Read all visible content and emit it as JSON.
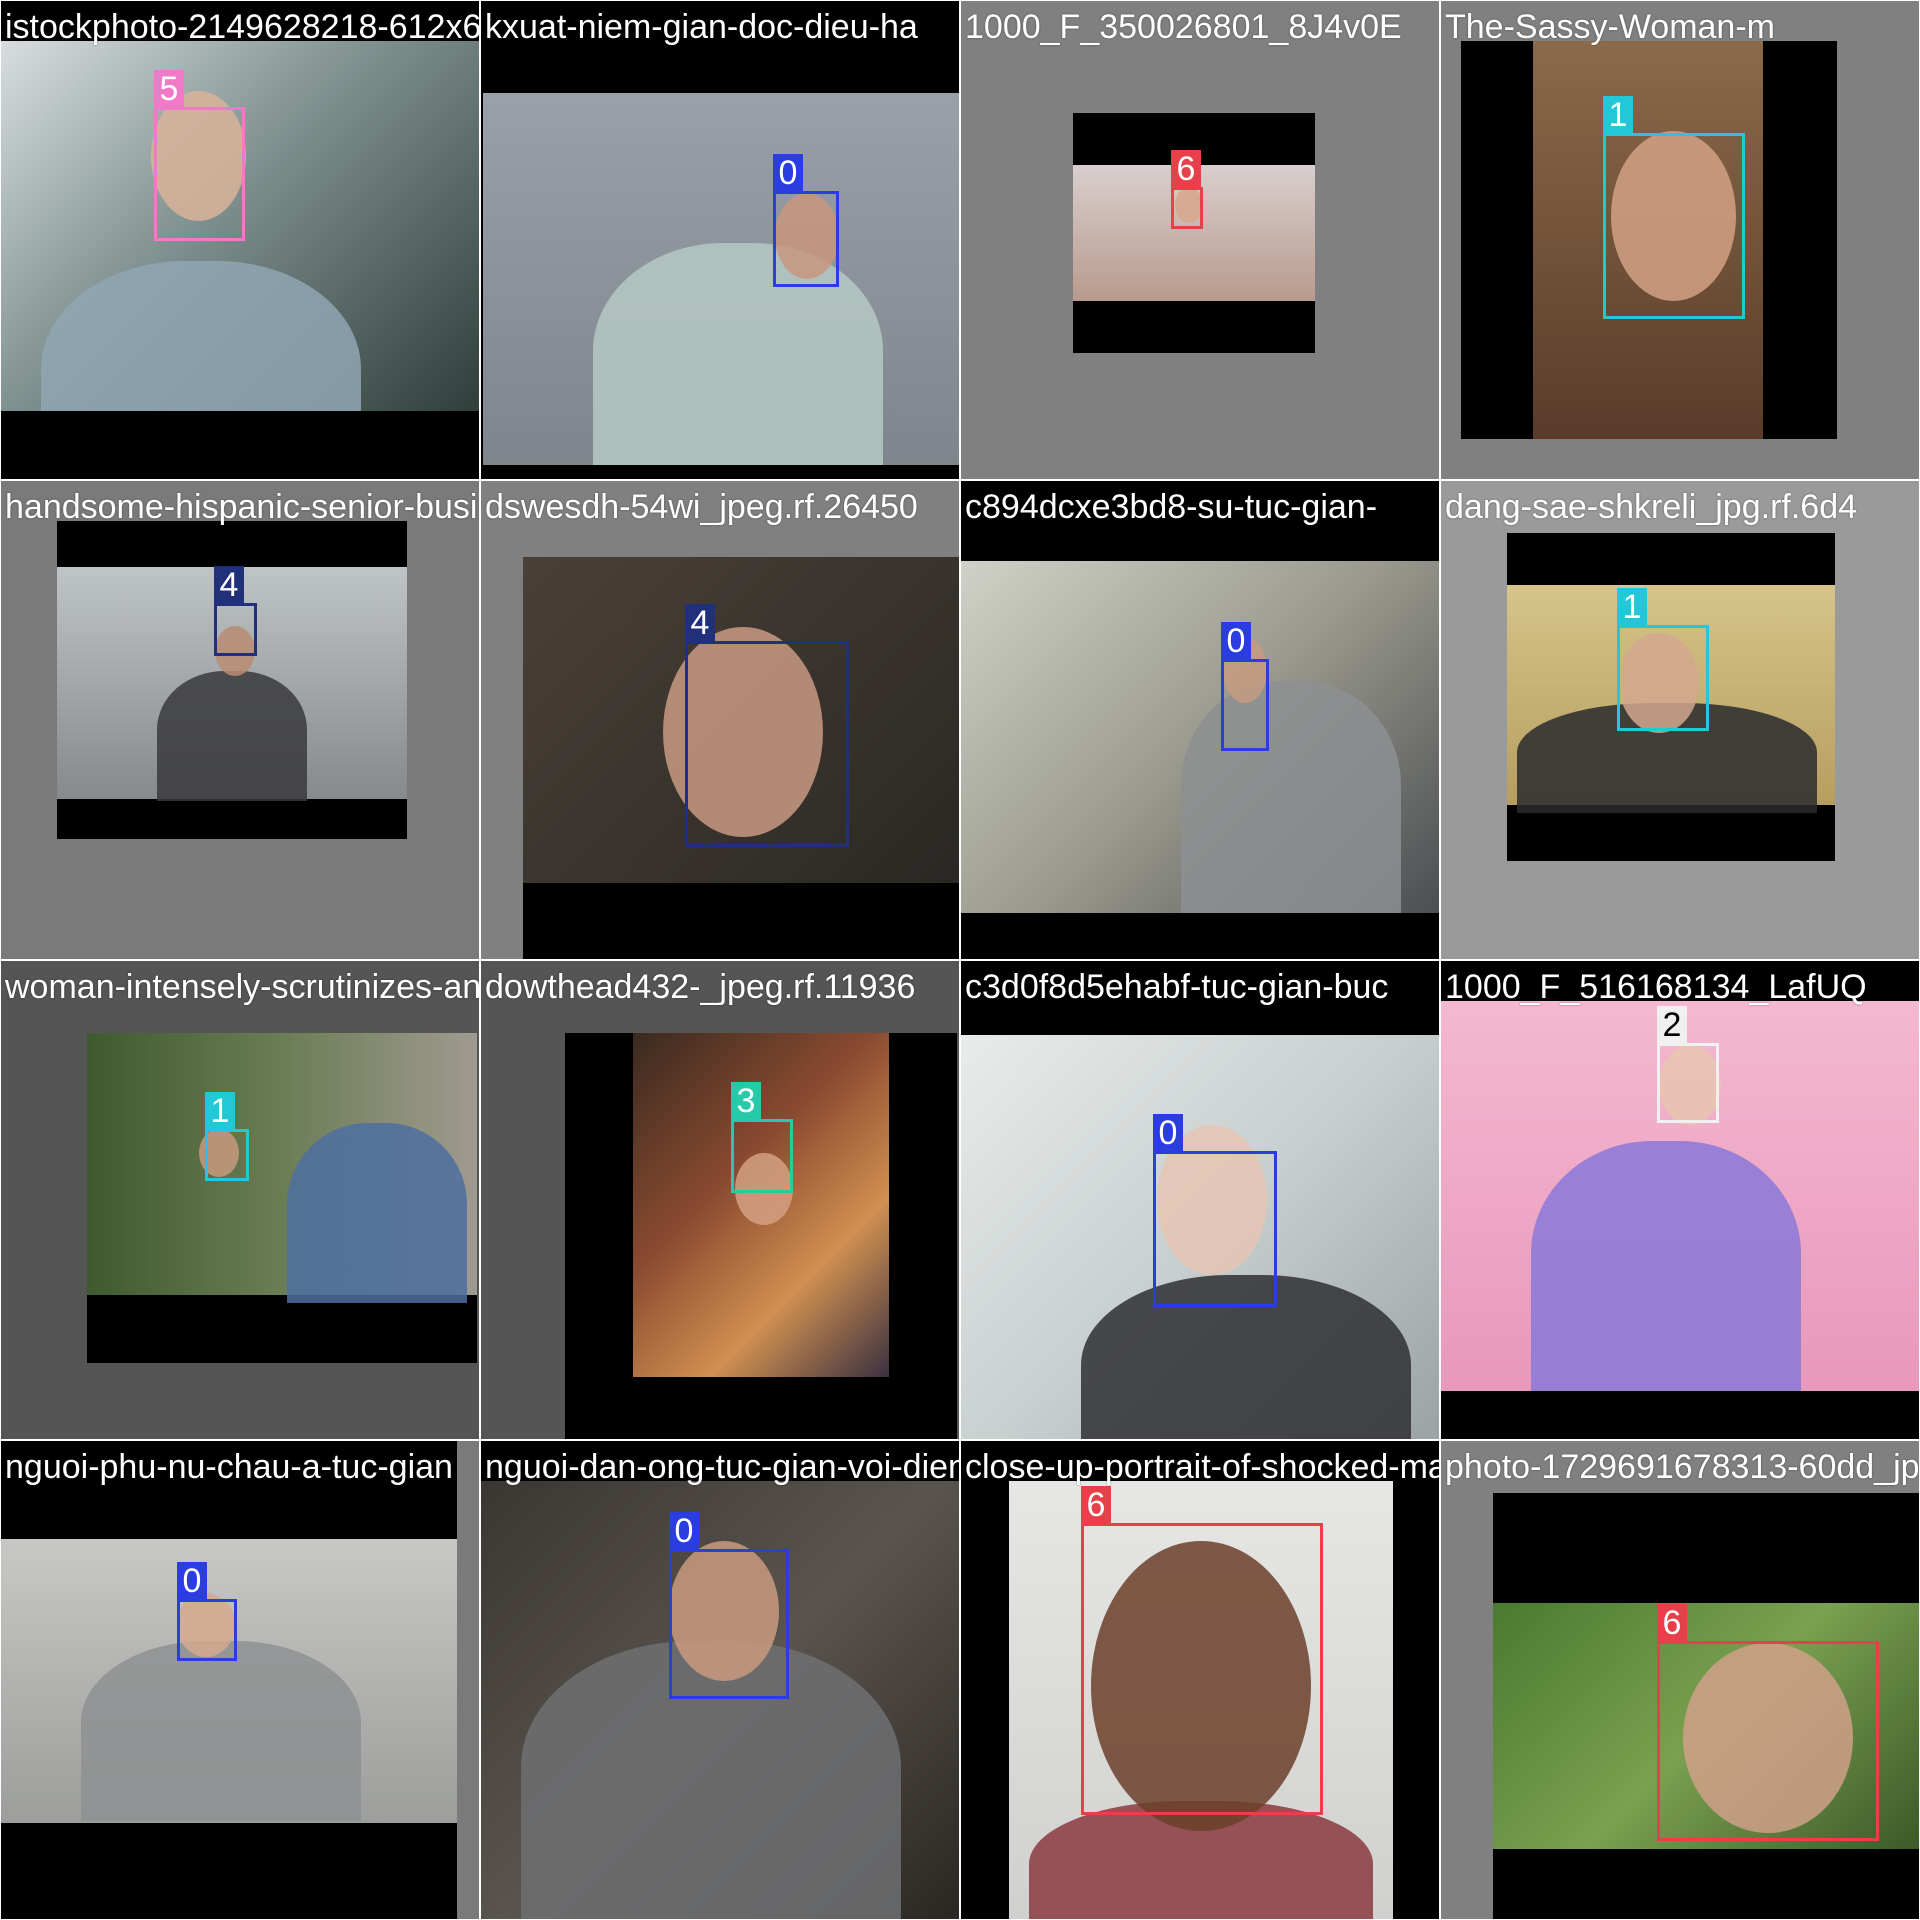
{
  "class_colors": {
    "0": "#2b3de0",
    "1": "#22c8d8",
    "2": "#f0f0f0",
    "3": "#26c9a8",
    "4": "#20307a",
    "5": "#f07ac8",
    "6": "#e8404a"
  },
  "tiles": [
    {
      "filename": "istockphoto-2149628218-612x612_jpg.rf.91",
      "label": "5"
    },
    {
      "filename": "kxuat-niem-gian-doc-dieu-ha",
      "label": "0"
    },
    {
      "filename": "1000_F_350026801_8J4v0E",
      "label": "6"
    },
    {
      "filename": "The-Sassy-Woman-m",
      "label": "1"
    },
    {
      "filename": "handsome-hispanic-senior-business-man-534-",
      "label": "4"
    },
    {
      "filename": "dswesdh-54wi_jpeg.rf.26450",
      "label": "4"
    },
    {
      "filename": "c894dcxe3bd8-su-tuc-gian-",
      "label": "0"
    },
    {
      "filename": "dang-sae-shkreli_jpg.rf.6d4",
      "label": "1"
    },
    {
      "filename": "woman-intensely-scrutinizes-another-",
      "label": "1"
    },
    {
      "filename": "dowthead432-_jpeg.rf.11936",
      "label": "3"
    },
    {
      "filename": "c3d0f8d5ehabf-tuc-gian-buc",
      "label": "0"
    },
    {
      "filename": "1000_F_516168134_LafUQ",
      "label": "2"
    },
    {
      "filename": "nguoi-phu-nu-chau-a-tuc-gian",
      "label": "0"
    },
    {
      "filename": "nguoi-dan-ong-tuc-gian-voi-dien-thoai",
      "label": "0"
    },
    {
      "filename": "close-up-portrait-of-shocked-man",
      "label": "6"
    },
    {
      "filename": "photo-1729691678313-60dd_jpg",
      "label": "6"
    }
  ]
}
